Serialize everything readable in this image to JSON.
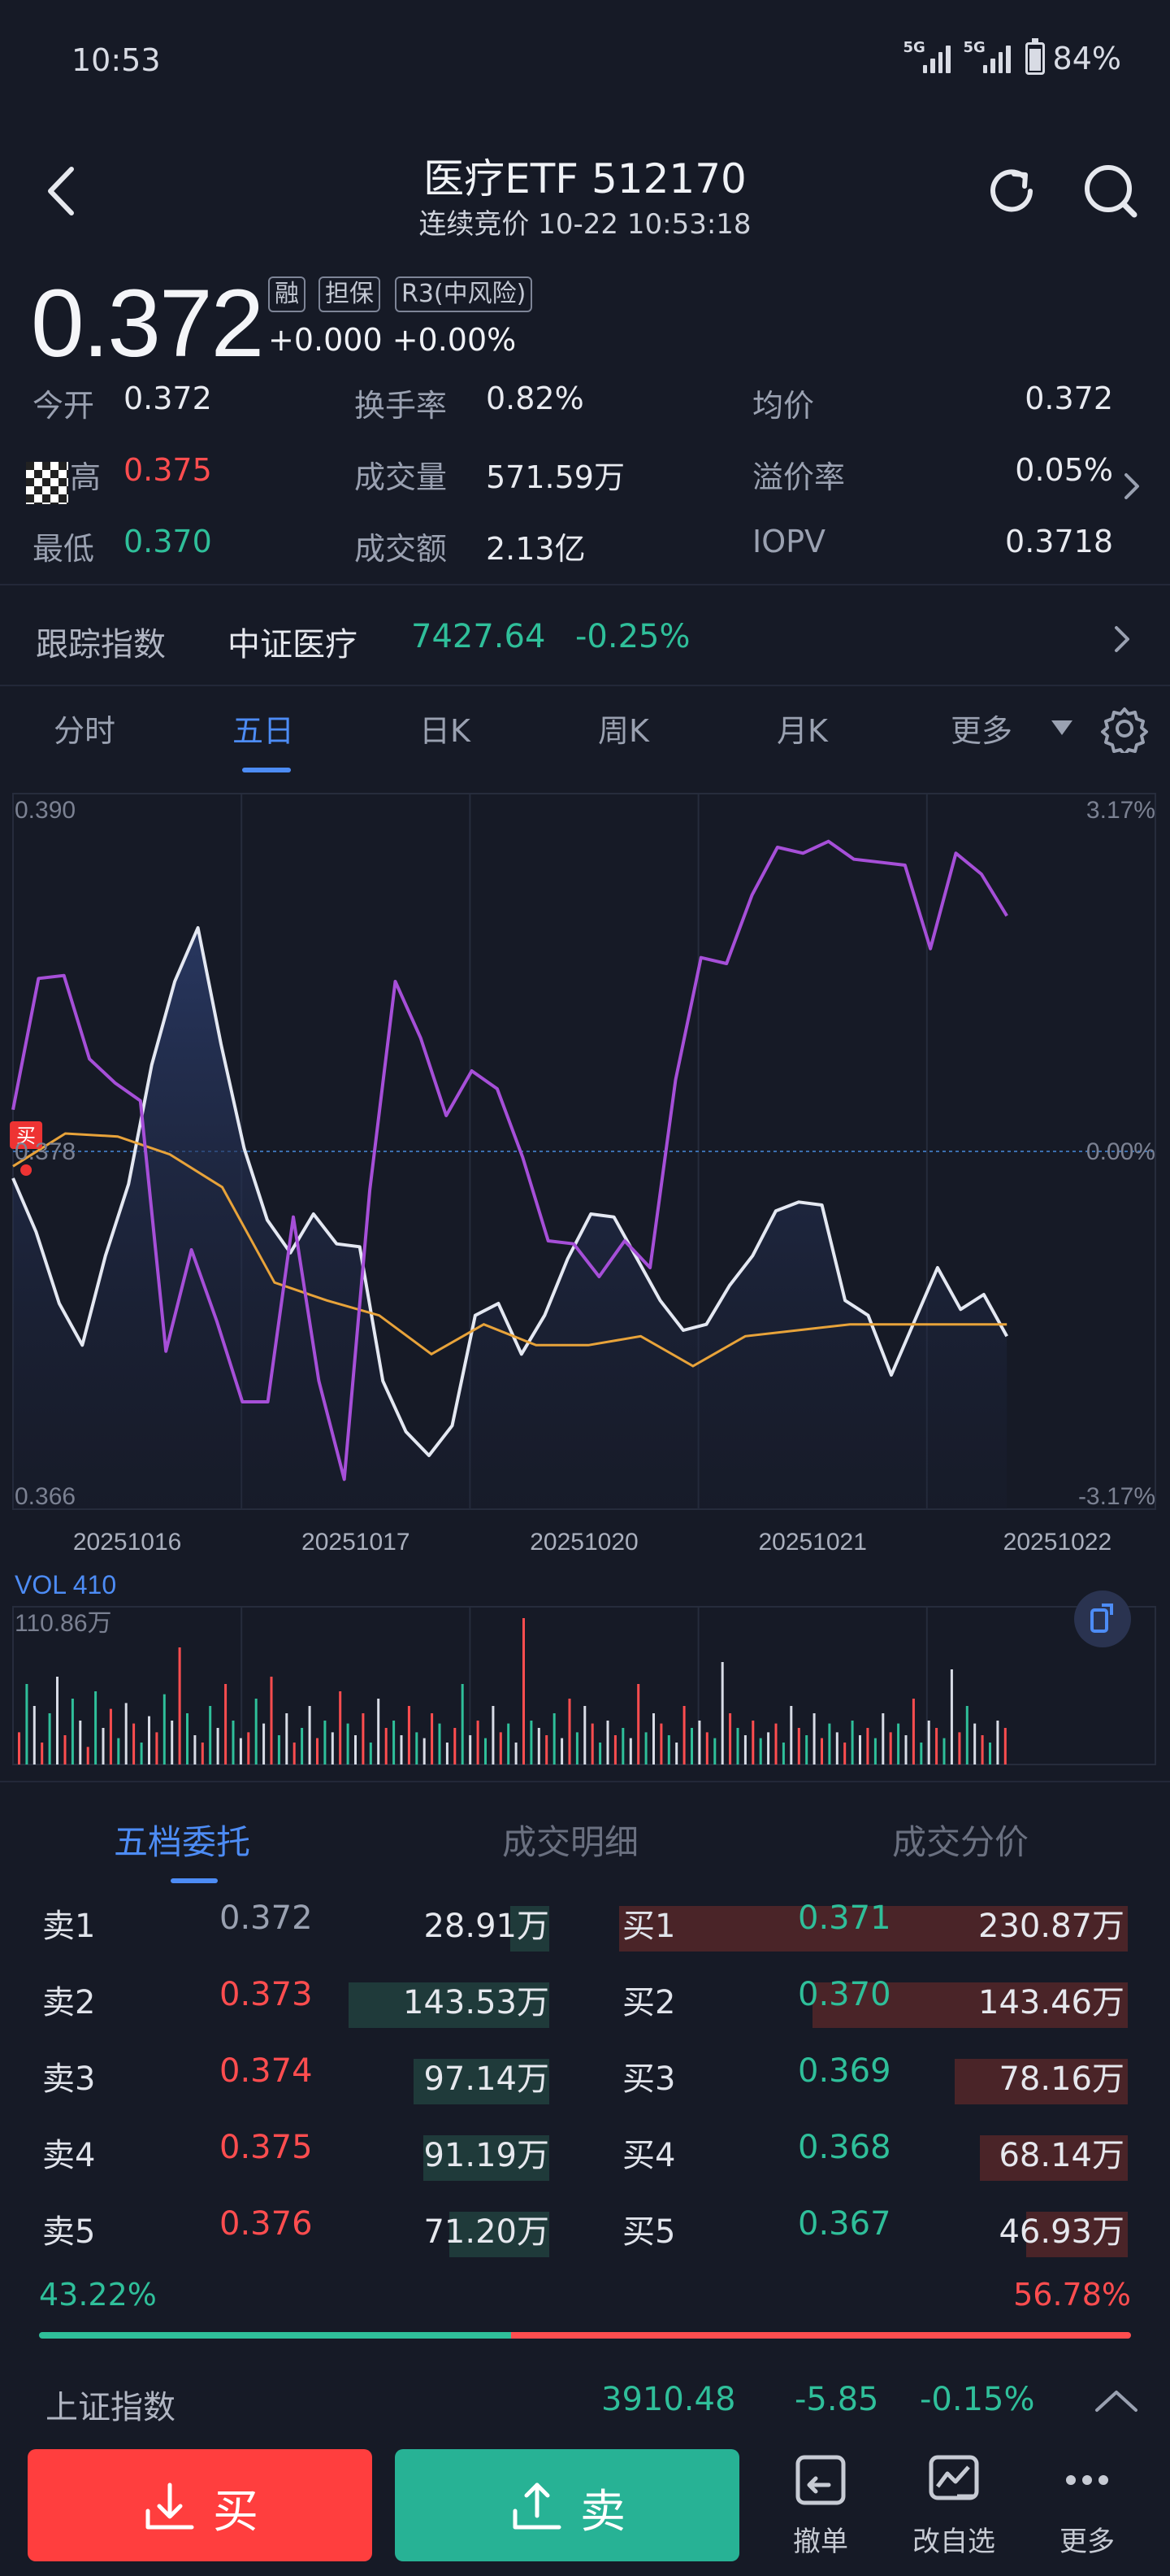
{
  "status_bar": {
    "time": "10:53",
    "signal1_label": "5G",
    "signal2_label": "5G",
    "battery": "84%"
  },
  "header": {
    "title": "医疗ETF 512170",
    "subtitle": "连续竞价 10-22 10:53:18"
  },
  "quote": {
    "price": "0.372",
    "tags": [
      "融",
      "担保",
      "R3(中风险)"
    ],
    "change": "+0.000 +0.00%",
    "stats": [
      {
        "label": "今开",
        "value": "0.372",
        "color": "white"
      },
      {
        "label": "换手率",
        "value": "0.82%",
        "color": "white"
      },
      {
        "label": "均价",
        "value": "0.372",
        "color": "white"
      },
      {
        "label": "最高",
        "value": "0.375",
        "color": "red"
      },
      {
        "label": "成交量",
        "value": "571.59万",
        "color": "white"
      },
      {
        "label": "溢价率",
        "value": "0.05%",
        "color": "white"
      },
      {
        "label": "最低",
        "value": "0.370",
        "color": "green"
      },
      {
        "label": "成交额",
        "value": "2.13亿",
        "color": "white"
      },
      {
        "label": "IOPV",
        "value": "0.3718",
        "color": "white"
      }
    ]
  },
  "tracking": {
    "label": "跟踪指数",
    "index_name": "中证医疗",
    "value": "7427.64",
    "change": "-0.25%"
  },
  "chart_tabs": [
    "分时",
    "五日",
    "日K",
    "周K",
    "月K",
    "更多"
  ],
  "chart_data": {
    "type": "line",
    "y_left_top": "0.390",
    "y_left_mid": "0.378",
    "y_left_bottom": "0.366",
    "y_right_top": "3.17%",
    "y_right_mid": "0.00%",
    "y_right_bottom": "-3.17%",
    "ylim": [
      0.366,
      0.39
    ],
    "x_dates": [
      "20251016",
      "20251017",
      "20251020",
      "20251021",
      "20251022"
    ],
    "buy_marker": "买",
    "series": [
      {
        "values": [
          0.3771,
          0.3753,
          0.3729,
          0.3715,
          0.3745,
          0.3769,
          0.3809,
          0.3837,
          0.3855,
          0.3816,
          0.3781,
          0.3757,
          0.3746,
          0.3759,
          0.3749,
          0.3748,
          0.3703,
          0.3686,
          0.3678,
          0.3688,
          0.3725,
          0.3729,
          0.3712,
          0.3725,
          0.3744,
          0.3759,
          0.3758,
          0.3744,
          0.373,
          0.372,
          0.3722,
          0.3735,
          0.3745,
          0.376,
          0.3763,
          0.3762,
          0.373,
          0.3725,
          0.3705,
          0.3723,
          0.3741,
          0.3727,
          0.3732,
          0.3718
        ]
      },
      {
        "values": [
          0.3775,
          0.3786,
          0.3785,
          0.3779,
          0.3768,
          0.3736,
          0.373,
          0.3725,
          0.3712,
          0.3722,
          0.3715,
          0.3715,
          0.3718,
          0.3708,
          0.3718,
          0.372,
          0.3722,
          0.3722,
          0.3722,
          0.3722
        ]
      },
      {
        "values": [
          0.3794,
          0.3838,
          0.3839,
          0.3811,
          0.3803,
          0.3797,
          0.3713,
          0.3747,
          0.3723,
          0.3696,
          0.3696,
          0.3758,
          0.3703,
          0.367,
          0.3767,
          0.3837,
          0.3818,
          0.3792,
          0.3807,
          0.3801,
          0.3778,
          0.375,
          0.3749,
          0.3738,
          0.375,
          0.3741,
          0.3804,
          0.3845,
          0.3843,
          0.3866,
          0.3882,
          0.388,
          0.3884,
          0.3878,
          0.3877,
          0.3876,
          0.3848,
          0.388,
          0.3873,
          0.3859
        ]
      }
    ]
  },
  "volume": {
    "label": "VOL 410",
    "max_label": "110.86万",
    "bars": [
      22,
      55,
      40,
      15,
      35,
      60,
      20,
      45,
      30,
      12,
      50,
      25,
      38,
      18,
      42,
      28,
      15,
      33,
      22,
      48,
      30,
      80,
      35,
      20,
      15,
      40,
      25,
      55,
      30,
      18,
      22,
      45,
      28,
      60,
      20,
      35,
      15,
      25,
      40,
      18,
      30,
      22,
      50,
      28,
      20,
      35,
      15,
      45,
      25,
      30,
      20,
      40,
      22,
      18,
      35,
      28,
      15,
      25,
      55,
      20,
      30,
      18,
      40,
      22,
      28,
      15,
      100,
      30,
      25,
      20,
      35,
      18,
      45,
      22,
      40,
      28,
      15,
      30,
      20,
      25,
      18,
      55,
      22,
      35,
      28,
      20,
      15,
      40,
      25,
      30,
      22,
      18,
      70,
      35,
      25,
      20,
      30,
      18,
      22,
      28,
      15,
      40,
      25,
      20,
      35,
      18,
      28,
      22,
      15,
      30,
      20,
      25,
      18,
      35,
      22,
      28,
      20,
      45,
      15,
      30,
      25,
      18,
      65,
      22,
      40,
      28,
      20,
      15,
      30,
      25
    ]
  },
  "order_tabs": [
    "五档委托",
    "成交明细",
    "成交分价"
  ],
  "asks": [
    {
      "label": "卖1",
      "price": "0.372",
      "volume": "28.91万",
      "price_color": "gray",
      "depth": 0.12
    },
    {
      "label": "卖2",
      "price": "0.373",
      "volume": "143.53万",
      "price_color": "red",
      "depth": 0.62
    },
    {
      "label": "卖3",
      "price": "0.374",
      "volume": "97.14万",
      "price_color": "red",
      "depth": 0.42
    },
    {
      "label": "卖4",
      "price": "0.375",
      "volume": "91.19万",
      "price_color": "red",
      "depth": 0.39
    },
    {
      "label": "卖5",
      "price": "0.376",
      "volume": "71.20万",
      "price_color": "red",
      "depth": 0.31
    }
  ],
  "bids": [
    {
      "label": "买1",
      "price": "0.371",
      "volume": "230.87万",
      "price_color": "green",
      "depth": 1.0
    },
    {
      "label": "买2",
      "price": "0.370",
      "volume": "143.46万",
      "price_color": "green",
      "depth": 0.62
    },
    {
      "label": "买3",
      "price": "0.369",
      "volume": "78.16万",
      "price_color": "green",
      "depth": 0.34
    },
    {
      "label": "买4",
      "price": "0.368",
      "volume": "68.14万",
      "price_color": "green",
      "depth": 0.29
    },
    {
      "label": "买5",
      "price": "0.367",
      "volume": "46.93万",
      "price_color": "green",
      "depth": 0.2
    }
  ],
  "ratio": {
    "sell_pct": "43.22%",
    "buy_pct": "56.78%",
    "sell_fraction": 0.4322
  },
  "index_bar": {
    "name": "上证指数",
    "value": "3910.48",
    "change": "-5.85",
    "change_pct": "-0.15%"
  },
  "actions": {
    "buy": "买",
    "sell": "卖",
    "tools": [
      "撤单",
      "改自选",
      "更多"
    ]
  },
  "colors": {
    "red": "#ff4d4f",
    "green": "#2fbf9a",
    "accent": "#4d8cf5",
    "avg_line": "#e8a33a",
    "index_line": "#a64fd8"
  }
}
